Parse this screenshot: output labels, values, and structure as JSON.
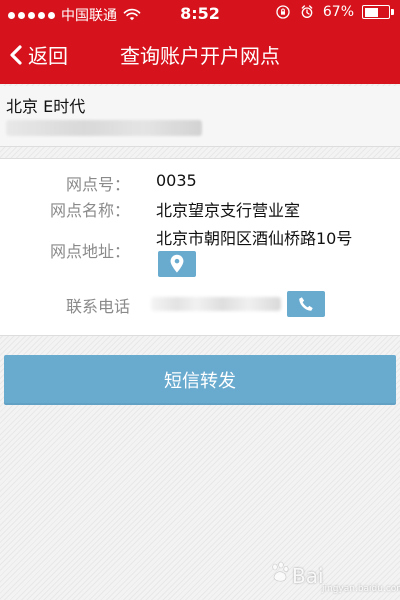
{
  "status_bar": {
    "carrier": "中国联通",
    "time": "8:52",
    "battery_percent_text": "67%",
    "battery_level": 0.67,
    "icons": [
      "signal-dots-icon",
      "wifi-icon",
      "orientation-lock-icon",
      "alarm-icon",
      "battery-icon"
    ]
  },
  "nav": {
    "back_label": "返回",
    "title": "查询账户开户网点"
  },
  "bank_band": {
    "bank_name": "北京  E时代"
  },
  "details": {
    "labels": {
      "branch_no": "网点号：",
      "branch_name": "网点名称：",
      "branch_address": "网点地址：",
      "contact_phone": "联系电话"
    },
    "values": {
      "branch_no": "0035",
      "branch_name": "北京望京支行营业室",
      "branch_address": "北京市朝阳区酒仙桥路10号"
    }
  },
  "actions": {
    "sms_forward": "短信转发"
  },
  "watermark": {
    "brand": "Bai",
    "sub": "jingyan.baidu.com"
  },
  "colors": {
    "header_red": "#d6131c",
    "button_blue": "#69aacf"
  }
}
